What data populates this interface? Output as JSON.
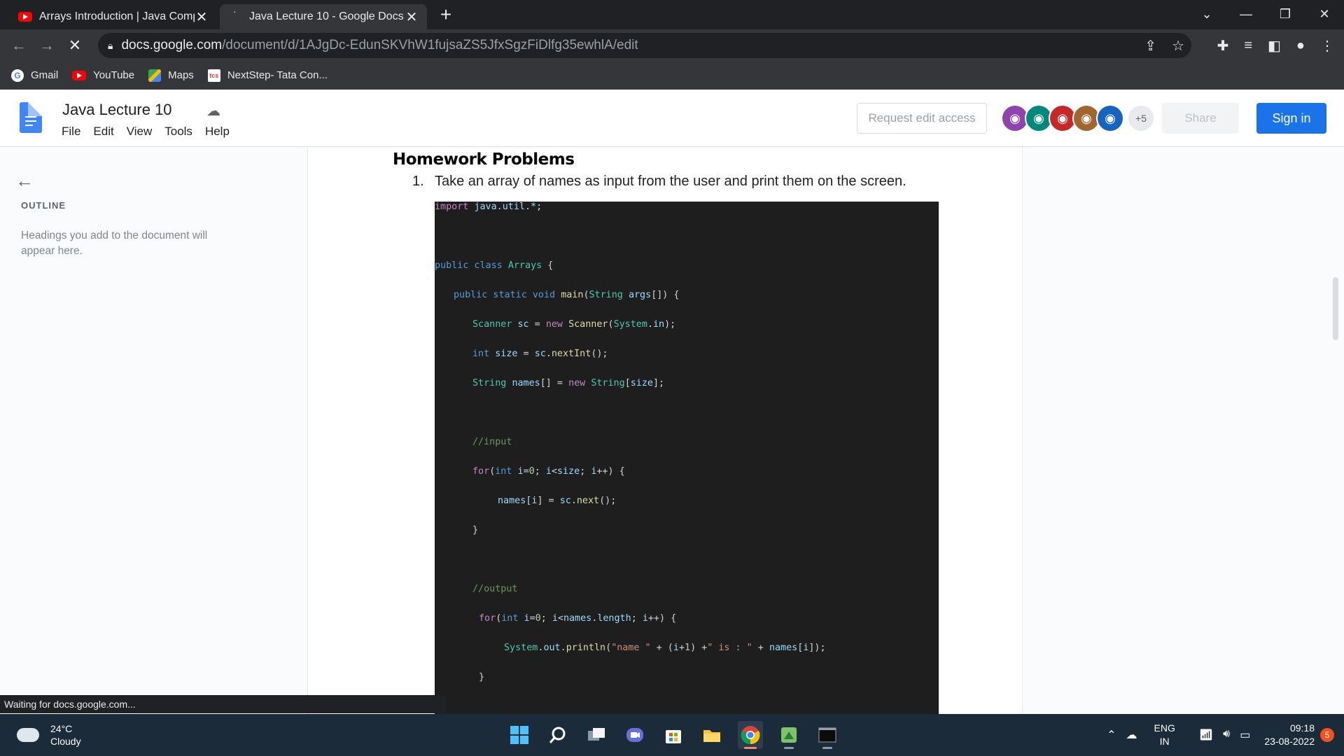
{
  "browser": {
    "tabs": [
      {
        "title": "Arrays Introduction | Java Compl",
        "active": false
      },
      {
        "title": "Java Lecture 10 - Google Docs",
        "active": true
      }
    ],
    "url_host": "docs.google.com",
    "url_path": "/document/d/1AJgDc-EdunSKVhW1fujsaZS5JfxSgzFiDlfg35ewhlA/edit",
    "bookmarks": [
      "Gmail",
      "YouTube",
      "Maps",
      "NextStep- Tata Con..."
    ],
    "status": "Waiting for docs.google.com..."
  },
  "docs": {
    "title": "Java Lecture 10",
    "menu": [
      "File",
      "Edit",
      "View",
      "Tools",
      "Help"
    ],
    "request_edit": "Request edit access",
    "avatar_more": "+5",
    "share": "Share",
    "sign_in": "Sign in"
  },
  "outline": {
    "heading": "OUTLINE",
    "hint": "Headings you add to the document will appear here."
  },
  "document": {
    "heading": "Homework Problems",
    "item_number": "1.",
    "item_text": "Take an array of names as input from the user and print them on the screen.",
    "code_lines": [
      "import java.util.*;",
      "public class Arrays {",
      "public static void main(String args[]) {",
      "Scanner sc = new Scanner(System.in);",
      "int size = sc.nextInt();",
      "String names[] = new String[size];",
      "//input",
      "for(int i=0; i<size; i++) {",
      "names[i] = sc.next();",
      "}",
      "//output",
      "for(int i=0; i<names.length; i++) {",
      "System.out.println(\"name \" + (i+1) +\" is : \" + names[i]);",
      "}"
    ]
  },
  "taskbar": {
    "temperature": "24°C",
    "weather": "Cloudy",
    "lang_1": "ENG",
    "lang_2": "IN",
    "time": "09:18",
    "date": "23-08-2022",
    "notifications": "5"
  },
  "colors": {
    "accent": "#1a73e8",
    "code_bg": "#1e1e1e",
    "chrome_dark": "#202124"
  }
}
